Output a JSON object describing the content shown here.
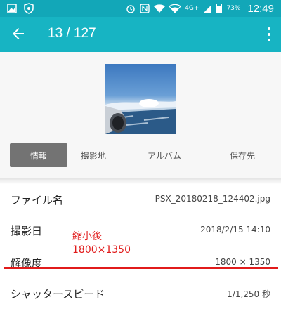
{
  "status_bar": {
    "network": "4G+",
    "battery": "73%",
    "time": "12:49",
    "icons": [
      "image-icon",
      "shield-icon",
      "alarm-icon",
      "nfc-icon",
      "wifi-icon",
      "wifi-icon",
      "signal-icon",
      "battery-icon"
    ]
  },
  "app_bar": {
    "title": "13 / 127",
    "back_icon": "back-arrow-icon",
    "menu_icon": "more-vert-icon",
    "color": "#17b4c3"
  },
  "tabs": [
    {
      "label": "情報",
      "active": true
    },
    {
      "label": "撮影地",
      "active": false
    },
    {
      "label": "アルバム",
      "active": false
    },
    {
      "label": "保存先",
      "active": false
    }
  ],
  "info": [
    {
      "key": "ファイル名",
      "value": "PSX_20180218_124402.jpg"
    },
    {
      "key": "撮影日",
      "value": "2018/2/15 14:10"
    },
    {
      "key": "解像度",
      "value": "1800 × 1350"
    },
    {
      "key": "シャッタースピード",
      "value": "1/1,250 秒"
    }
  ],
  "annotation": {
    "line1": "縮小後",
    "line2": "1800×1350",
    "color": "#e11b1b"
  }
}
